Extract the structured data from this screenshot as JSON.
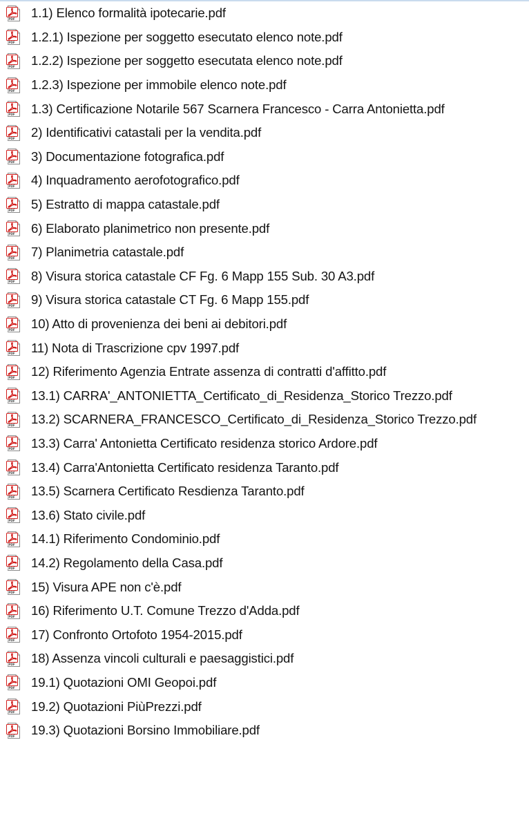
{
  "icon": "pdf-file-icon",
  "files": [
    {
      "name": "1.1) Elenco formalità ipotecarie.pdf"
    },
    {
      "name": "1.2.1) Ispezione per soggetto esecutato elenco note.pdf"
    },
    {
      "name": "1.2.2) Ispezione per soggetto esecutata elenco note.pdf"
    },
    {
      "name": "1.2.3) Ispezione per immobile elenco note.pdf"
    },
    {
      "name": "1.3) Certificazione Notarile 567 Scarnera Francesco - Carra Antonietta.pdf"
    },
    {
      "name": "2) Identificativi catastali per la vendita.pdf"
    },
    {
      "name": "3) Documentazione fotografica.pdf"
    },
    {
      "name": "4) Inquadramento aerofotografico.pdf"
    },
    {
      "name": "5) Estratto di mappa catastale.pdf"
    },
    {
      "name": "6) Elaborato planimetrico non presente.pdf"
    },
    {
      "name": "7) Planimetria catastale.pdf"
    },
    {
      "name": "8) Visura storica catastale CF Fg. 6 Mapp 155 Sub. 30 A3.pdf"
    },
    {
      "name": "9) Visura storica catastale CT Fg. 6 Mapp 155.pdf"
    },
    {
      "name": "10) Atto di provenienza dei beni ai debitori.pdf"
    },
    {
      "name": "11) Nota di Trascrizione cpv 1997.pdf"
    },
    {
      "name": "12) Riferimento Agenzia Entrate assenza di contratti d'affitto.pdf"
    },
    {
      "name": "13.1) CARRA'_ANTONIETTA_Certificato_di_Residenza_Storico Trezzo.pdf"
    },
    {
      "name": "13.2) SCARNERA_FRANCESCO_Certificato_di_Residenza_Storico Trezzo.pdf"
    },
    {
      "name": "13.3) Carra' Antonietta Certificato residenza storico Ardore.pdf"
    },
    {
      "name": "13.4) Carra'Antonietta Certificato residenza Taranto.pdf"
    },
    {
      "name": "13.5) Scarnera Certificato Resdienza Taranto.pdf"
    },
    {
      "name": "13.6) Stato civile.pdf"
    },
    {
      "name": "14.1) Riferimento Condominio.pdf"
    },
    {
      "name": "14.2) Regolamento della Casa.pdf"
    },
    {
      "name": "15) Visura APE non c'è.pdf"
    },
    {
      "name": "16) Riferimento U.T. Comune Trezzo d'Adda.pdf"
    },
    {
      "name": "17) Confronto Ortofoto 1954-2015.pdf"
    },
    {
      "name": "18) Assenza vincoli culturali e paesaggistici.pdf"
    },
    {
      "name": "19.1) Quotazioni OMI Geopoi.pdf"
    },
    {
      "name": "19.2) Quotazioni PiùPrezzi.pdf"
    },
    {
      "name": "19.3) Quotazioni Borsino Immobiliare.pdf"
    }
  ]
}
